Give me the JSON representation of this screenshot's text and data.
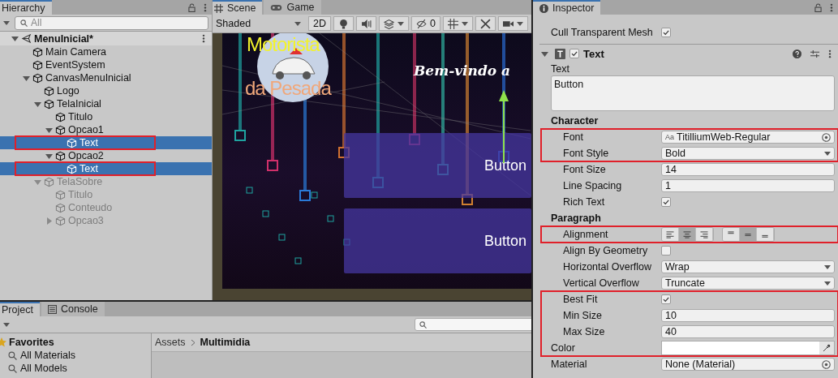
{
  "hierarchy": {
    "tab": "Hierarchy",
    "search": {
      "placeholder": "All"
    },
    "scene": {
      "name": "MenuInicial*",
      "expanded": true,
      "children": [
        {
          "name": "Main Camera",
          "selected": false,
          "disabled": false,
          "marked": false
        },
        {
          "name": "EventSystem",
          "selected": false,
          "disabled": false,
          "marked": false
        },
        {
          "name": "CanvasMenuInicial",
          "selected": false,
          "disabled": false,
          "marked": false,
          "expanded": true,
          "children": [
            {
              "name": "Logo",
              "selected": false,
              "disabled": false,
              "marked": false
            },
            {
              "name": "TelaInicial",
              "selected": false,
              "disabled": false,
              "marked": false,
              "expanded": true,
              "children": [
                {
                  "name": "Titulo",
                  "selected": false,
                  "disabled": false,
                  "marked": false
                },
                {
                  "name": "Opcao1",
                  "selected": false,
                  "disabled": false,
                  "marked": false,
                  "expanded": true,
                  "children": [
                    {
                      "name": "Text",
                      "selected": true,
                      "disabled": false,
                      "marked": true
                    }
                  ]
                },
                {
                  "name": "Opcao2",
                  "selected": false,
                  "disabled": false,
                  "marked": false,
                  "expanded": true,
                  "children": [
                    {
                      "name": "Text",
                      "selected": true,
                      "disabled": false,
                      "marked": true
                    }
                  ]
                }
              ]
            },
            {
              "name": "TelaSobre",
              "selected": false,
              "disabled": true,
              "marked": false,
              "expanded": true,
              "children": [
                {
                  "name": "Titulo",
                  "selected": false,
                  "disabled": true,
                  "marked": false
                },
                {
                  "name": "Conteudo",
                  "selected": false,
                  "disabled": true,
                  "marked": false
                },
                {
                  "name": "Opcao3",
                  "selected": false,
                  "disabled": true,
                  "marked": false,
                  "expanded": false
                }
              ]
            }
          ]
        }
      ]
    }
  },
  "scene_panel": {
    "tabs": [
      {
        "label": "Scene",
        "selected": true,
        "kind": "scene"
      },
      {
        "label": "Game",
        "selected": false,
        "kind": "game"
      }
    ],
    "toolbar": {
      "shading": "Shaded",
      "mode_2d": "2D",
      "hidden_count": "0"
    },
    "view": {
      "logo_top": "Motorista",
      "logo_bottom": "da Pesada",
      "welcome": "Bem-vindo a",
      "buttons": [
        "Button",
        "Button"
      ]
    }
  },
  "inspector": {
    "tab": "Inspector",
    "rows": [
      {
        "kind": "checkbox",
        "label": "Cull Transparent Mesh",
        "checked": true,
        "nested": false,
        "boxed": false
      },
      {
        "kind": "component",
        "label": "Text",
        "enabled": true,
        "expanded": true,
        "boxed": false
      },
      {
        "kind": "textarea",
        "label": "Text",
        "value": "Button",
        "boxed": false
      },
      {
        "kind": "section",
        "label": "Character",
        "boxed": false
      },
      {
        "kind": "object",
        "label": "Font",
        "value": "TitilliumWeb-Regular",
        "asset_icon": "Aa",
        "nested": true,
        "boxed": true
      },
      {
        "kind": "dropdown",
        "label": "Font Style",
        "value": "Bold",
        "nested": true,
        "boxed": true
      },
      {
        "kind": "field",
        "label": "Font Size",
        "value": "14",
        "nested": true,
        "boxed": false
      },
      {
        "kind": "field",
        "label": "Line Spacing",
        "value": "1",
        "nested": true,
        "boxed": false
      },
      {
        "kind": "checkbox",
        "label": "Rich Text",
        "checked": true,
        "nested": true,
        "boxed": false
      },
      {
        "kind": "section",
        "label": "Paragraph",
        "boxed": false
      },
      {
        "kind": "alignment",
        "label": "Alignment",
        "nested": true,
        "boxed": true,
        "horizontal": [
          {
            "selected": false
          },
          {
            "selected": true
          },
          {
            "selected": false
          }
        ],
        "vertical": [
          {
            "selected": false
          },
          {
            "selected": true
          },
          {
            "selected": false
          }
        ]
      },
      {
        "kind": "checkbox",
        "label": "Align By Geometry",
        "checked": false,
        "nested": true,
        "boxed": false
      },
      {
        "kind": "dropdown",
        "label": "Horizontal Overflow",
        "value": "Wrap",
        "nested": true,
        "boxed": false
      },
      {
        "kind": "dropdown",
        "label": "Vertical Overflow",
        "value": "Truncate",
        "nested": true,
        "boxed": false
      },
      {
        "kind": "checkbox",
        "label": "Best Fit",
        "checked": true,
        "nested": true,
        "boxed": true
      },
      {
        "kind": "field",
        "label": "Min Size",
        "value": "10",
        "nested": true,
        "boxed": true
      },
      {
        "kind": "field",
        "label": "Max Size",
        "value": "40",
        "nested": true,
        "boxed": true
      },
      {
        "kind": "color",
        "label": "Color",
        "color": "#ffffff",
        "nested": false,
        "boxed": true
      },
      {
        "kind": "object",
        "label": "Material",
        "value": "None (Material)",
        "nested": false,
        "boxed": false
      }
    ]
  },
  "project": {
    "tabs": [
      {
        "label": "Project",
        "selected": true,
        "kind": "project"
      },
      {
        "label": "Console",
        "selected": false,
        "kind": "console"
      }
    ],
    "favorites": {
      "label": "Favorites",
      "items": [
        "All Materials",
        "All Models"
      ]
    },
    "breadcrumb": [
      "Assets",
      "Multimidia"
    ]
  }
}
